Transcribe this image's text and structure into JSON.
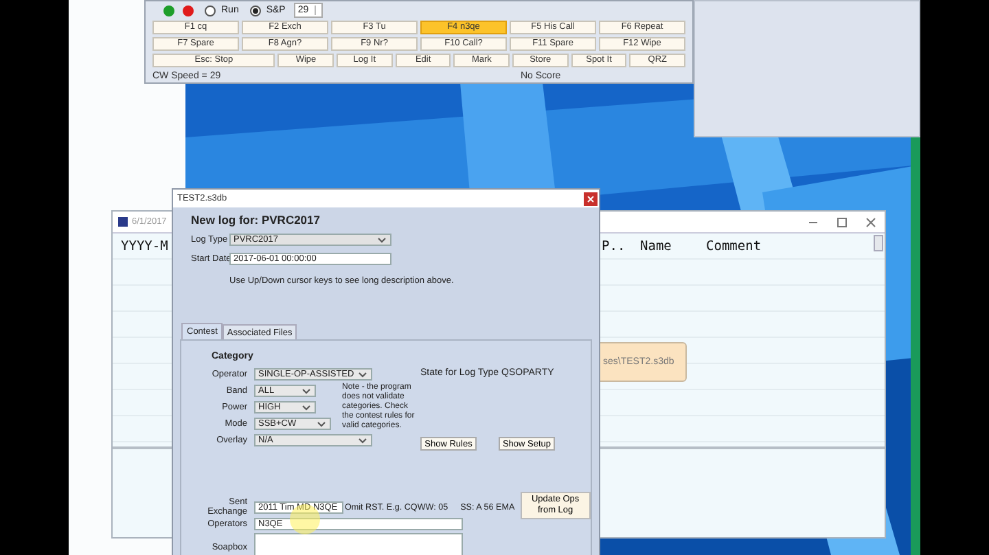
{
  "keyer_window": {
    "leds": [
      {
        "color": "#1e9e2a"
      },
      {
        "color": "#e01b1b"
      }
    ],
    "modes": [
      {
        "label": "Run",
        "selected": false
      },
      {
        "label": "S&P",
        "selected": true
      }
    ],
    "speed": "29",
    "key_rows": [
      [
        {
          "label": "F1 cq",
          "highlighted": false
        },
        {
          "label": "F2 Exch",
          "highlighted": false
        },
        {
          "label": "F3 Tu",
          "highlighted": false
        },
        {
          "label": "F4 n3qe",
          "highlighted": true
        },
        {
          "label": "F5 His Call",
          "highlighted": false
        },
        {
          "label": "F6 Repeat",
          "highlighted": false
        }
      ],
      [
        {
          "label": "F7 Spare",
          "highlighted": false
        },
        {
          "label": "F8 Agn?",
          "highlighted": false
        },
        {
          "label": "F9 Nr?",
          "highlighted": false
        },
        {
          "label": "F10 Call?",
          "highlighted": false
        },
        {
          "label": "F11 Spare",
          "highlighted": false
        },
        {
          "label": "F12 Wipe",
          "highlighted": false
        }
      ],
      [
        {
          "label": "Esc: Stop",
          "highlighted": false
        },
        {
          "label": "Wipe",
          "highlighted": false
        },
        {
          "label": "Log It",
          "highlighted": false
        },
        {
          "label": "Edit",
          "highlighted": false
        },
        {
          "label": "Mark",
          "highlighted": false
        },
        {
          "label": "Store",
          "highlighted": false
        },
        {
          "label": "Spot It",
          "highlighted": false
        },
        {
          "label": "QRZ",
          "highlighted": false
        }
      ]
    ],
    "status_left": "CW Speed = 29",
    "status_right": "No Score"
  },
  "log_window": {
    "title": "6/1/2017",
    "columns": [
      "YYYY-M",
      "P..",
      "Name",
      "Comment"
    ],
    "callout": "ses\\TEST2.s3db"
  },
  "dialog": {
    "title": "TEST2.s3db",
    "heading": "New log for: PVRC2017",
    "log_type": {
      "label": "Log Type",
      "value": "PVRC2017"
    },
    "start_date": {
      "label": "Start Date",
      "value": "2017-06-01 00:00:00"
    },
    "hint": "Use Up/Down cursor keys to see long description above.",
    "tabs": [
      {
        "label": "Contest",
        "selected": true
      },
      {
        "label": "Associated Files",
        "selected": false
      }
    ],
    "category": {
      "title": "Category",
      "fields": [
        {
          "label": "Operator",
          "value": "SINGLE-OP-ASSISTED"
        },
        {
          "label": "Band",
          "value": "ALL"
        },
        {
          "label": "Power",
          "value": "HIGH"
        },
        {
          "label": "Mode",
          "value": "SSB+CW"
        },
        {
          "label": "Overlay",
          "value": "N/A"
        }
      ],
      "note": "Note -  the program does not validate categories. Check the contest rules for valid categories.",
      "state_text": "State for Log Type QSOPARTY",
      "buttons": [
        "Show Rules",
        "Show Setup"
      ]
    },
    "sent_exchange": {
      "label": "Sent Exchange",
      "value": "2011 Tim MD N3QE"
    },
    "exchange_hints": [
      "Omit RST. E.g. CQWW: 05",
      "SS: A 56 EMA"
    ],
    "update_button": "Update Ops from Log",
    "operators": {
      "label": "Operators",
      "value": "N3QE"
    },
    "soapbox": {
      "label": "Soapbox"
    }
  }
}
